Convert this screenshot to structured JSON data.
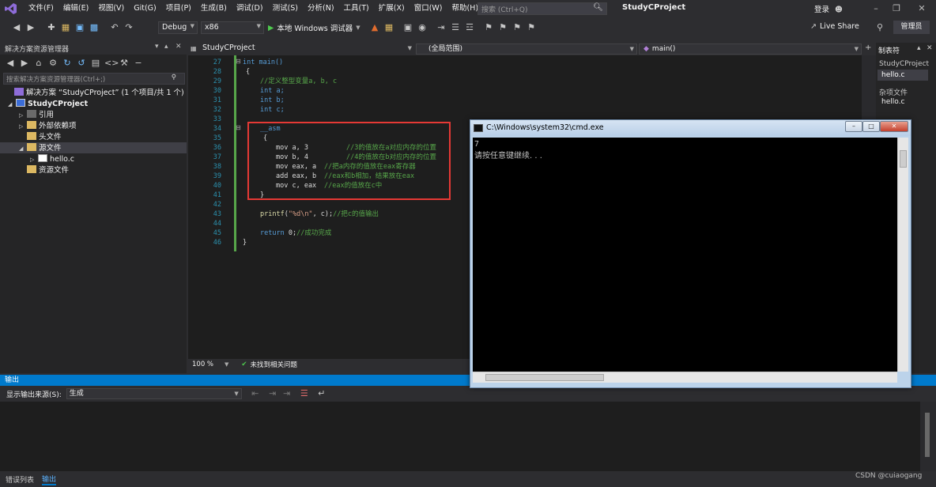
{
  "menubar": {
    "items": [
      "文件(F)",
      "编辑(E)",
      "视图(V)",
      "Git(G)",
      "项目(P)",
      "生成(B)",
      "调试(D)",
      "测试(S)",
      "分析(N)",
      "工具(T)",
      "扩展(X)",
      "窗口(W)",
      "帮助(H)"
    ],
    "search_placeholder": "搜索 (Ctrl+Q)",
    "project_title": "StudyCProject",
    "login": "登录"
  },
  "toolbar": {
    "config": "Debug",
    "platform": "x86",
    "run_label": "本地 Windows 调试器",
    "live_share": "Live Share",
    "admin": "管理员"
  },
  "solution_explorer": {
    "title": "解决方案资源管理器",
    "search_placeholder": "搜索解决方案资源管理器(Ctrl+;)",
    "items": [
      {
        "label": "解决方案 “StudyCProject” (1 个项目/共 1 个)"
      },
      {
        "label": "StudyCProject"
      },
      {
        "label": "引用"
      },
      {
        "label": "外部依赖项"
      },
      {
        "label": "头文件"
      },
      {
        "label": "源文件"
      },
      {
        "label": "hello.c"
      },
      {
        "label": "资源文件"
      }
    ]
  },
  "editor": {
    "tab": "StudyCProject",
    "scope": "(全局范围)",
    "function": "main()",
    "zoom": "100 %",
    "status": "未找到相关问题",
    "line_numbers": [
      "27",
      "28",
      "29",
      "30",
      "31",
      "32",
      "33",
      "34",
      "35",
      "36",
      "37",
      "38",
      "39",
      "40",
      "41",
      "42",
      "43",
      "44",
      "45",
      "46"
    ],
    "lines": {
      "l27": "int main()",
      "l28": "{",
      "l29": "//定义整型变量a, b, c",
      "l30": "int a;",
      "l31": "int b;",
      "l32": "int c;",
      "l34": "__asm",
      "l35": "{",
      "l36_code": "mov a, 3",
      "l36_cm": "//3的值放在a对应内存的位置",
      "l37_code": "mov b, 4",
      "l37_cm": "//4的值放在b对应内存的位置",
      "l38_code": "mov eax, a",
      "l38_cm": "//把a内存的值放在eax寄存器",
      "l39_code": "add eax, b",
      "l39_cm": "//eax和b相加，结果放在eax",
      "l40_code": "mov c, eax",
      "l40_cm": "//eax的值放在c中",
      "l41": "}",
      "l43_fn": "printf",
      "l43_str": "\"%d\\n\"",
      "l43_rest": ", c);",
      "l43_cm": "//把c的值输出",
      "l45_kw": "return",
      "l45_rest": " 0;",
      "l45_cm": "//成功完成",
      "l46": "}"
    }
  },
  "right_panel": {
    "title": "制表符",
    "project": "StudyCProject",
    "file1": "hello.c",
    "misc": "杂项文件",
    "file2": "hello.c"
  },
  "output": {
    "title": "输出",
    "source_label": "显示输出来源(S):",
    "source_value": "生成",
    "bottom_tabs": [
      "错误列表",
      "输出"
    ]
  },
  "cmd": {
    "title": "C:\\Windows\\system32\\cmd.exe",
    "line1": "7",
    "line2": "请按任意键继续. . ."
  },
  "watermark": "CSDN @cuiaogang"
}
